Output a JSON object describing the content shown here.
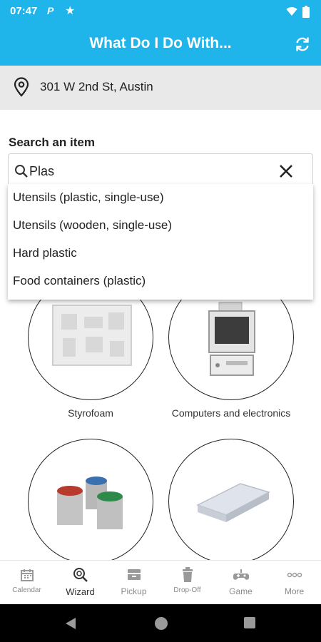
{
  "status_bar": {
    "time": "07:47",
    "parking_glyph": "P"
  },
  "app_bar": {
    "title": "What Do I Do With..."
  },
  "location": {
    "address": "301 W 2nd St, Austin"
  },
  "search": {
    "label": "Search an item",
    "value": "Plas",
    "suggestions": [
      "Utensils (plastic, single-use)",
      "Utensils (wooden, single-use)",
      "Hard plastic",
      "Food containers (plastic)"
    ]
  },
  "items": [
    {
      "label": "Styrofoam",
      "icon": "styrofoam-image"
    },
    {
      "label": "Computers and electronics",
      "icon": "computer-image"
    },
    {
      "label": "",
      "icon": "paint-cans-image"
    },
    {
      "label": "",
      "icon": "mattress-image"
    }
  ],
  "nav": {
    "items": [
      {
        "label": "Calendar",
        "icon": "calendar-icon"
      },
      {
        "label": "Wizard",
        "icon": "wizard-search-icon"
      },
      {
        "label": "Pickup",
        "icon": "pickup-truck-icon"
      },
      {
        "label": "Drop-Off",
        "icon": "drop-off-bin-icon"
      },
      {
        "label": "Game",
        "icon": "game-controller-icon"
      },
      {
        "label": "More",
        "icon": "more-dots-icon"
      }
    ],
    "active": "Wizard"
  },
  "colors": {
    "primary": "#1fb4ea",
    "location_bg": "#e9e9e9",
    "nav_inactive": "#8a8a8a"
  }
}
